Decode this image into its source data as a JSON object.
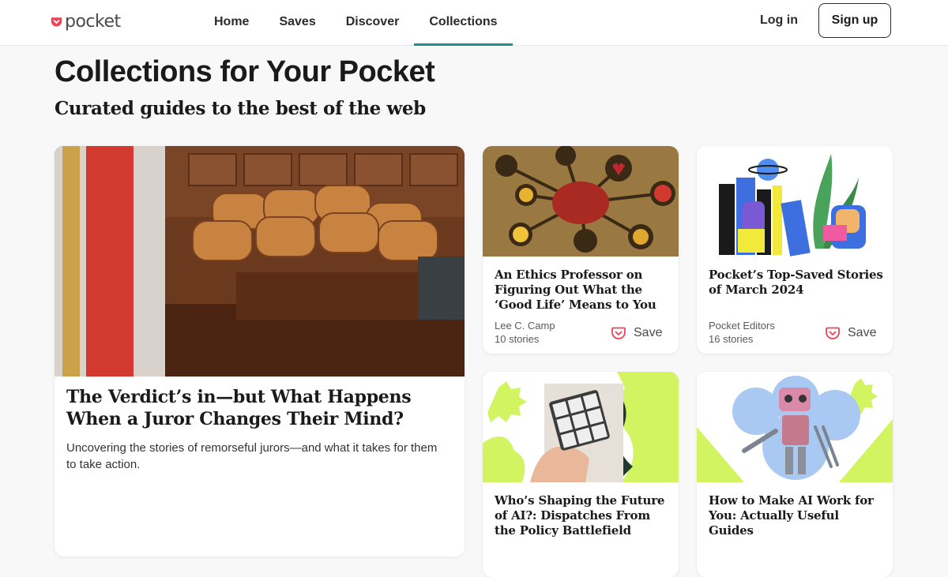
{
  "brand": {
    "name": "pocket",
    "color": "#ef4056"
  },
  "nav": {
    "items": [
      {
        "label": "Home"
      },
      {
        "label": "Saves"
      },
      {
        "label": "Discover"
      },
      {
        "label": "Collections",
        "active": true
      }
    ],
    "accent": "#1f8f8a"
  },
  "auth": {
    "login": "Log in",
    "signup": "Sign up"
  },
  "page": {
    "title": "Collections for Your Pocket",
    "subtitle": "Curated guides to the best of the web"
  },
  "featured": {
    "title": "The Verdict’s in—but What Happens When a Juror Changes Their Mind?",
    "description": "Uncovering the stories of remorseful jurors—and what it takes for them to take action.",
    "image": "courtroom-jury-box"
  },
  "collections": [
    {
      "title": "An Ethics Professor on Figuring Out What the ‘Good Life’ Means to You",
      "author": "Lee C. Camp",
      "count": "10 stories",
      "save": "Save",
      "image": "brain-emotions-illustration"
    },
    {
      "title": "Pocket’s Top-Saved Stories of March 2024",
      "author": "Pocket Editors",
      "count": "16 stories",
      "save": "Save",
      "image": "reading-people-illustration"
    },
    {
      "title": "Who’s Shaping the Future of AI?: Dispatches From the Policy Battlefield",
      "image": "rubiks-cube-hand"
    },
    {
      "title": "How to Make AI Work for You: Actually Useful Guides",
      "image": "robot-with-tools"
    }
  ]
}
